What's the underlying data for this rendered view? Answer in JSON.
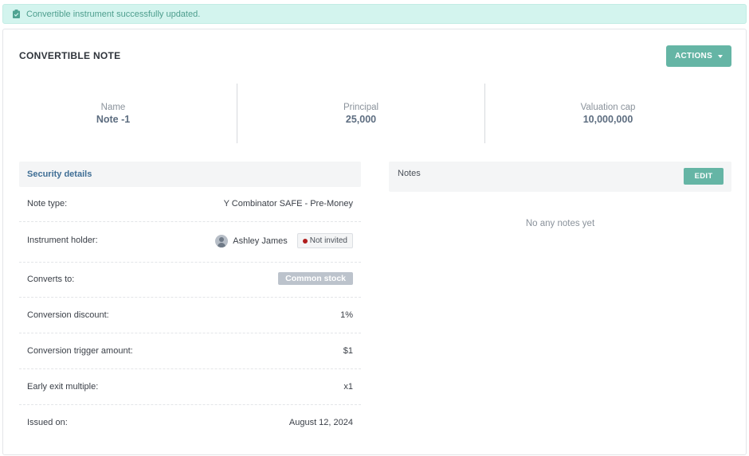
{
  "alert": {
    "icon": "clipboard-check-icon",
    "text": "Convertible instrument successfully updated."
  },
  "header": {
    "title": "CONVERTIBLE NOTE",
    "actions_label": "ACTIONS"
  },
  "summary": [
    {
      "label": "Name",
      "value": "Note -1"
    },
    {
      "label": "Principal",
      "value": "25,000"
    },
    {
      "label": "Valuation cap",
      "value": "10,000,000"
    }
  ],
  "security": {
    "title": "Security details",
    "rows": [
      {
        "label": "Note type:",
        "value": "Y Combinator SAFE - Pre-Money"
      },
      {
        "label": "Instrument holder:",
        "holder_name": "Ashley James",
        "status": "Not invited"
      },
      {
        "label": "Converts to:",
        "value": "Common stock"
      },
      {
        "label": "Conversion discount:",
        "value": "1%"
      },
      {
        "label": "Conversion trigger amount:",
        "value": "$1"
      },
      {
        "label": "Early exit multiple:",
        "value": "x1"
      },
      {
        "label": "Issued on:",
        "value": "August 12, 2024"
      }
    ]
  },
  "notes": {
    "title": "Notes",
    "edit_label": "EDIT",
    "empty_text": "No any notes yet"
  },
  "colors": {
    "accent": "#65b5a5",
    "alert_bg": "#d3f4ee",
    "status_dot": "#b01d1d"
  }
}
